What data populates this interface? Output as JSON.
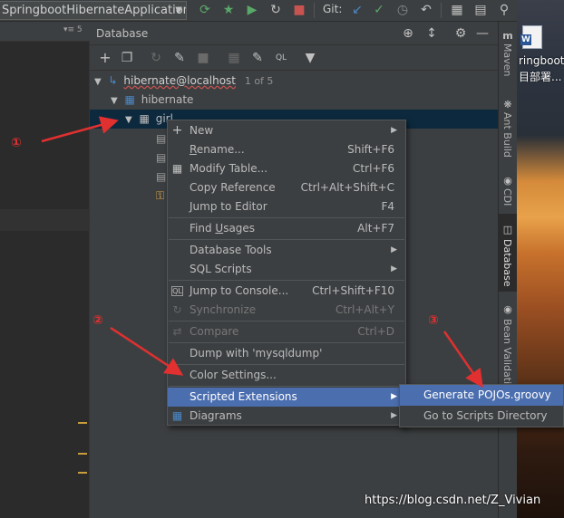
{
  "toolbar": {
    "run_config": "SpringbootHibernateApplication",
    "git_label": "Git:"
  },
  "editor": {
    "tab_count": "▾≡ 5"
  },
  "database": {
    "title": "Database",
    "tree": {
      "datasource": "hibernate@localhost",
      "datasource_count": "1 of 5",
      "schema": "hibernate",
      "table": "girl"
    }
  },
  "context_menu": {
    "items": [
      {
        "label": "New",
        "shortcut": "",
        "submenu": true
      },
      {
        "label": "Rename...",
        "underline": "R",
        "shortcut": "Shift+F6"
      },
      {
        "label": "Modify Table...",
        "shortcut": "Ctrl+F6"
      },
      {
        "label": "Copy Reference",
        "shortcut": "Ctrl+Alt+Shift+C"
      },
      {
        "label": "Jump to Editor",
        "shortcut": "F4"
      },
      {
        "label": "Find Usages",
        "shortcut": "Alt+F7"
      },
      {
        "label": "Database Tools",
        "shortcut": "",
        "submenu": true
      },
      {
        "label": "SQL Scripts",
        "shortcut": "",
        "submenu": true
      },
      {
        "label": "Jump to Console...",
        "shortcut": "Ctrl+Shift+F10"
      },
      {
        "label": "Synchronize",
        "shortcut": "Ctrl+Alt+Y",
        "disabled": true
      },
      {
        "label": "Compare",
        "shortcut": "Ctrl+D",
        "disabled": true
      },
      {
        "label": "Dump with 'mysqldump'",
        "shortcut": ""
      },
      {
        "label": "Color Settings...",
        "shortcut": ""
      },
      {
        "label": "Scripted Extensions",
        "shortcut": "",
        "submenu": true,
        "selected": true
      },
      {
        "label": "Diagrams",
        "shortcut": "",
        "submenu": true
      }
    ]
  },
  "submenu": {
    "items": [
      {
        "label": "Generate POJOs.groovy",
        "selected": true
      },
      {
        "label": "Go to Scripts Directory"
      }
    ]
  },
  "right_tools": [
    "Maven",
    "Ant Build",
    "CDI",
    "Database",
    "Bean Validation"
  ],
  "desktop": {
    "file_label_1": "ringboot",
    "file_label_2": "目部署..."
  },
  "annotations": {
    "one": "①",
    "two": "②",
    "three": "③",
    "watermark": "https://blog.csdn.net/Z_Vivian"
  },
  "colors": {
    "selection": "#4b6eaf",
    "annotation_red": "#e03030",
    "panel_bg": "#3c3f41"
  }
}
